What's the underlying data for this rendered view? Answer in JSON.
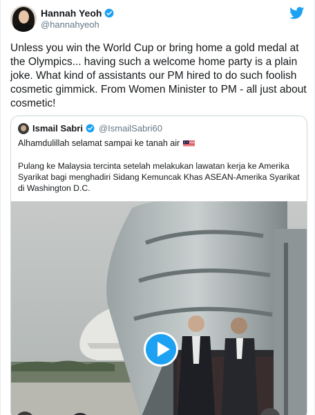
{
  "author": {
    "display_name": "Hannah Yeoh",
    "handle": "@hannahyeoh"
  },
  "tweet": {
    "text": "Unless you win the World Cup or bring home a gold medal at the Olympics... having such a welcome home party is a plain joke. What kind of assistants our PM hired to do such foolish cosmetic gimmick. From Women Minister to PM - all just about cosmetic!"
  },
  "quoted": {
    "display_name": "Ismail Sabri",
    "handle": "@IsmailSabri60",
    "line1": "Alhamdulillah selamat sampai ke tanah air",
    "body": "Pulang ke Malaysia tercinta setelah melakukan lawatan kerja ke Amerika Syarikat bagi menghadiri Sidang Kemuncak Khas ASEAN-Amerika Syarikat di Washington D.C."
  },
  "icons": {
    "verified": "verified-badge-icon",
    "brand": "twitter-bird-icon",
    "play": "play-icon",
    "flag": "malaysia-flag-icon"
  },
  "colors": {
    "brand_blue": "#1da1f2",
    "text": "#14171a",
    "secondary_text": "#657786"
  }
}
